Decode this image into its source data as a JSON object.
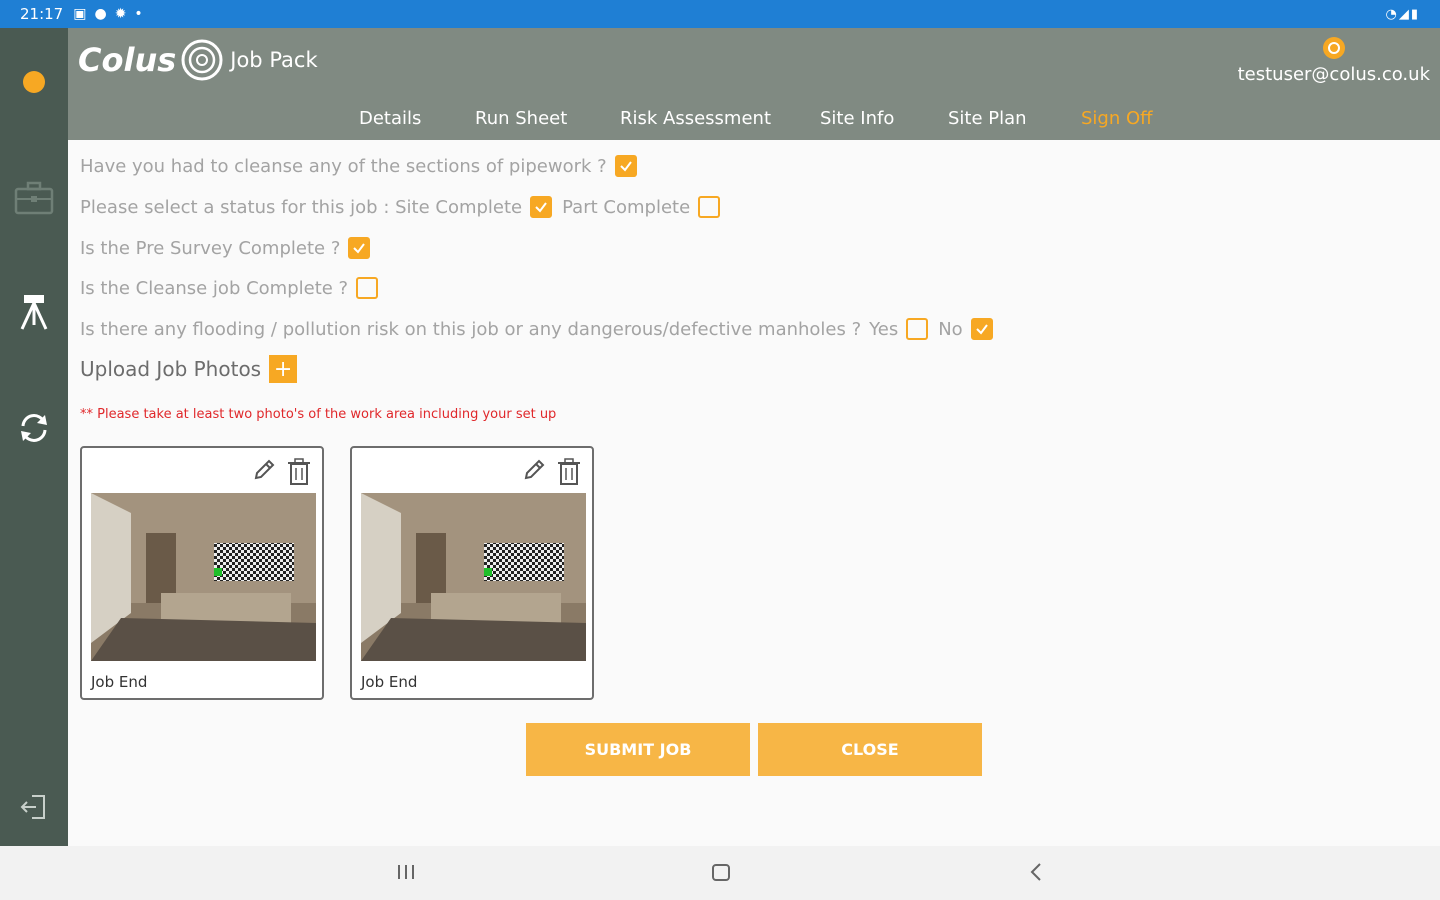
{
  "status_bar": {
    "time": "21:17"
  },
  "header": {
    "brand": "Colus",
    "app_name": "Job Pack",
    "user_email": "testuser@colus.co.uk"
  },
  "nav": {
    "tabs": [
      {
        "label": "Details",
        "active": false
      },
      {
        "label": "Run Sheet",
        "active": false
      },
      {
        "label": "Risk Assessment",
        "active": false
      },
      {
        "label": "Site Info",
        "active": false
      },
      {
        "label": "Site Plan",
        "active": false
      },
      {
        "label": "Sign Off",
        "active": true
      }
    ]
  },
  "form": {
    "q1": {
      "text": "Have you had to cleanse any of the sections of pipework ?",
      "checked": true
    },
    "q2": {
      "text": "Please select a status for this job : Site Complete",
      "checked": true,
      "option2_label": "Part Complete",
      "option2_checked": false
    },
    "q3": {
      "text": "Is the Pre Survey Complete ?",
      "checked": true
    },
    "q4": {
      "text": "Is the Cleanse job Complete ?",
      "checked": false
    },
    "q5": {
      "text": "Is there any flooding / pollution risk on this job or any dangerous/defective manholes ?",
      "yes_label": "Yes",
      "yes_checked": false,
      "no_label": "No",
      "no_checked": true
    },
    "upload_label": "Upload Job Photos",
    "upload_note": "** Please take at least two photo's of the work area including your set up"
  },
  "photos": [
    {
      "caption": "Job End"
    },
    {
      "caption": "Job End"
    }
  ],
  "buttons": {
    "submit": "SUBMIT JOB",
    "close": "CLOSE"
  },
  "colors": {
    "accent": "#f7a823",
    "sidebar": "#4a5a52",
    "header": "#808a82",
    "statusbar": "#1f7fd4",
    "note": "#e0282b"
  }
}
